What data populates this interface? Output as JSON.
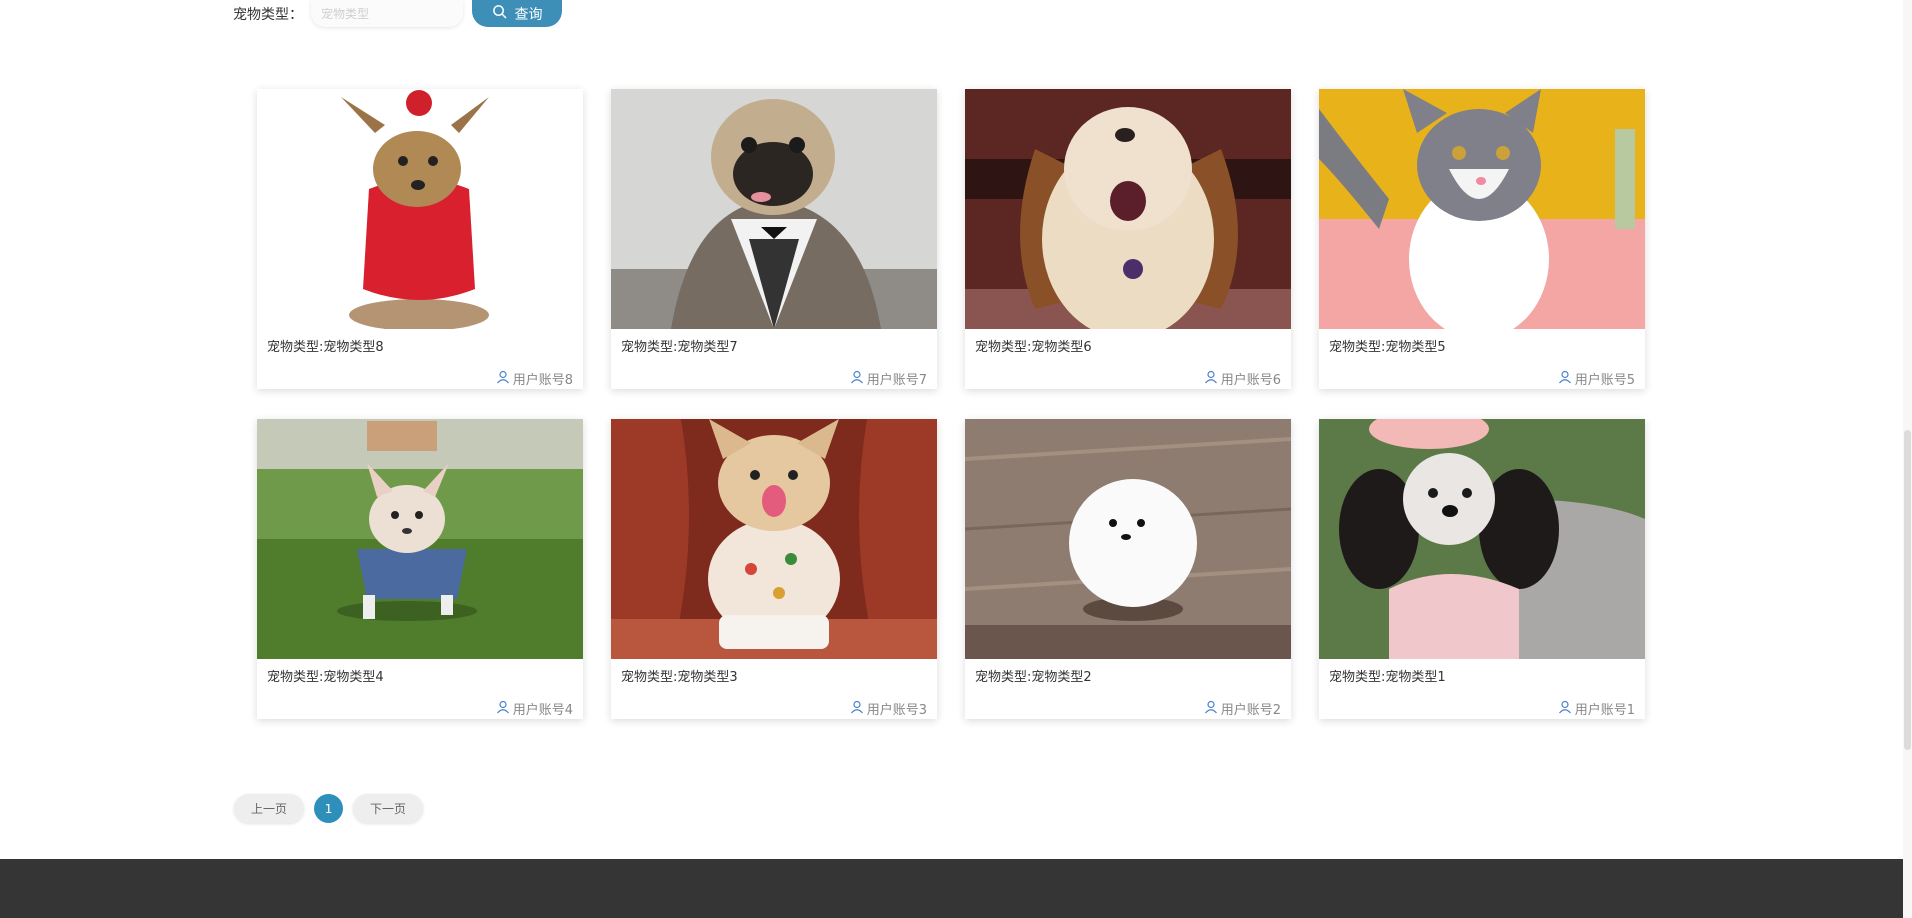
{
  "search": {
    "label": "宠物类型：",
    "placeholder": "宠物类型",
    "button_label": "查询",
    "button_icon": "search-icon"
  },
  "cards": [
    {
      "title": "宠物类型:宠物类型8",
      "user": "用户账号8",
      "user_icon": "user-icon",
      "image": "yorkshire-terrier-red-sweater"
    },
    {
      "title": "宠物类型:宠物类型7",
      "user": "用户账号7",
      "user_icon": "user-icon",
      "image": "pug-in-tuxedo"
    },
    {
      "title": "宠物类型:宠物类型6",
      "user": "用户账号6",
      "user_icon": "user-icon",
      "image": "shih-tzu-puppy"
    },
    {
      "title": "宠物类型:宠物类型5",
      "user": "用户账号5",
      "user_icon": "user-icon",
      "image": "grey-white-kitten"
    },
    {
      "title": "宠物类型:宠物类型4",
      "user": "用户账号4",
      "user_icon": "user-icon",
      "image": "french-bulldog-on-grass"
    },
    {
      "title": "宠物类型:宠物类型3",
      "user": "用户账号3",
      "user_icon": "user-icon",
      "image": "corgi-with-bib"
    },
    {
      "title": "宠物类型:宠物类型2",
      "user": "用户账号2",
      "user_icon": "user-icon",
      "image": "white-pomeranian-on-wood"
    },
    {
      "title": "宠物类型:宠物类型1",
      "user": "用户账号1",
      "user_icon": "user-icon",
      "image": "black-white-poodle-pink-bow"
    }
  ],
  "pagination": {
    "prev_label": "上一页",
    "current_page": "1",
    "next_label": "下一页"
  },
  "colors": {
    "accent": "#3d8fb8",
    "footer": "#353535"
  }
}
